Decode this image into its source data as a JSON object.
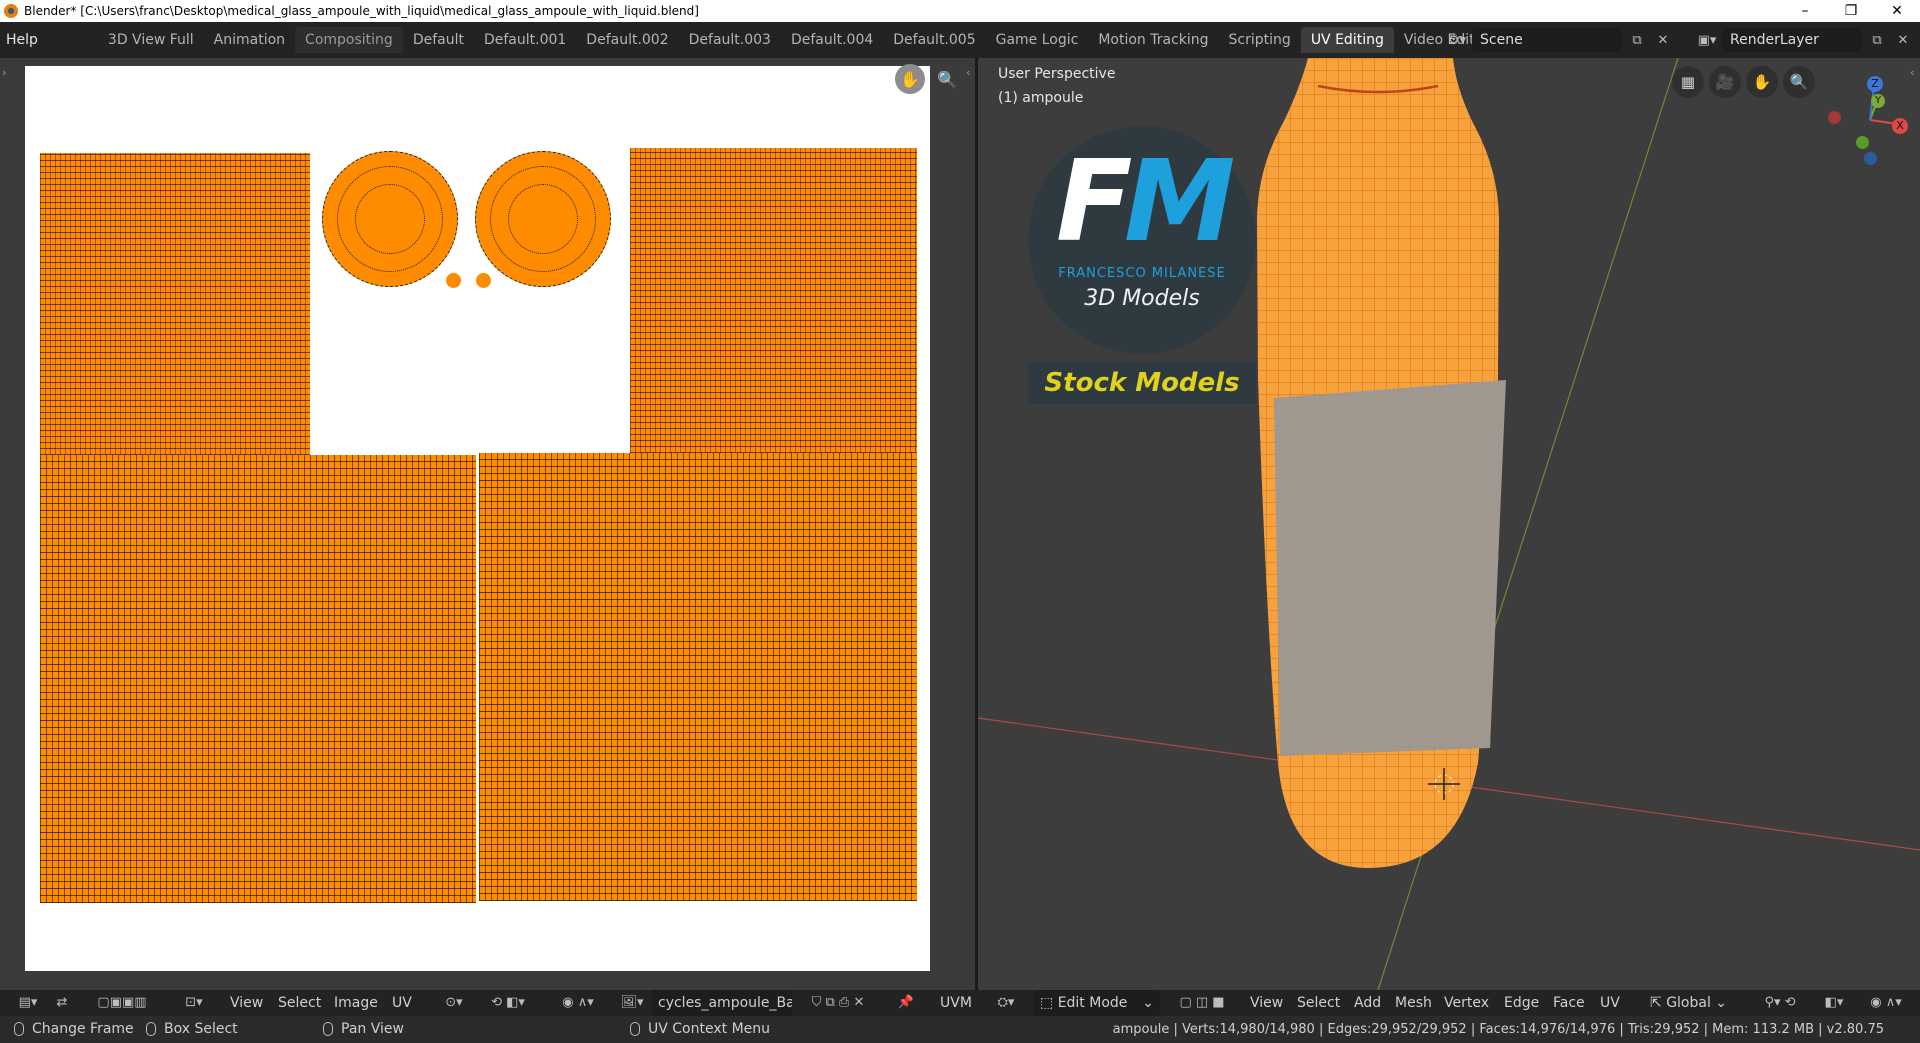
{
  "window": {
    "title": "Blender* [C:\\Users\\franc\\Desktop\\medical_glass_ampoule_with_liquid\\medical_glass_ampoule_with_liquid.blend]",
    "minimize": "–",
    "restore": "❐",
    "close": "✕"
  },
  "topbar": {
    "help": "Help",
    "workspaces": [
      "3D View Full",
      "Animation",
      "Compositing",
      "Default",
      "Default.001",
      "Default.002",
      "Default.003",
      "Default.004",
      "Default.005",
      "Game Logic",
      "Motion Tracking",
      "Scripting",
      "UV Editing",
      "Video Editing"
    ],
    "active_workspace": "UV Editing",
    "add_tab": "+",
    "scene_name": "Scene",
    "render_layer": "RenderLayer"
  },
  "uv_editor": {
    "colors": {
      "island": "#ff8c00",
      "canvas": "#ffffff",
      "panel": "#3b3b3b"
    }
  },
  "viewport": {
    "perspective_label": "User Perspective",
    "object_label": "(1) ampoule",
    "watermark": {
      "letter_f": "F",
      "letter_m": "M",
      "name": "FRANCESCO MILANESE",
      "subtitle": "3D Models",
      "stock": "Stock Models"
    },
    "gizmo": {
      "z": "Z",
      "y": "Y",
      "x": "X"
    },
    "colors": {
      "mesh": "#f7a23c",
      "selected_band": "#9a9a9a",
      "background": "#3d3d3d"
    }
  },
  "uv_header": {
    "menus": [
      "View",
      "Select",
      "Image",
      "UV"
    ],
    "image_name": "cycles_ampoule_Ba...",
    "uvm_label": "UVM"
  },
  "viewport_header": {
    "mode": "Edit Mode",
    "menus": [
      "View",
      "Select",
      "Add",
      "Mesh",
      "Vertex",
      "Edge",
      "Face",
      "UV"
    ],
    "transform_orientation": "Global"
  },
  "statusbar": {
    "hints": [
      "Change Frame",
      "Box Select",
      "Pan View",
      "UV Context Menu"
    ],
    "stats": "ampoule | Verts:14,980/14,980 | Edges:29,952/29,952 | Faces:14,976/14,976 | Tris:29,952 | Mem: 113.2 MB | v2.80.75"
  }
}
